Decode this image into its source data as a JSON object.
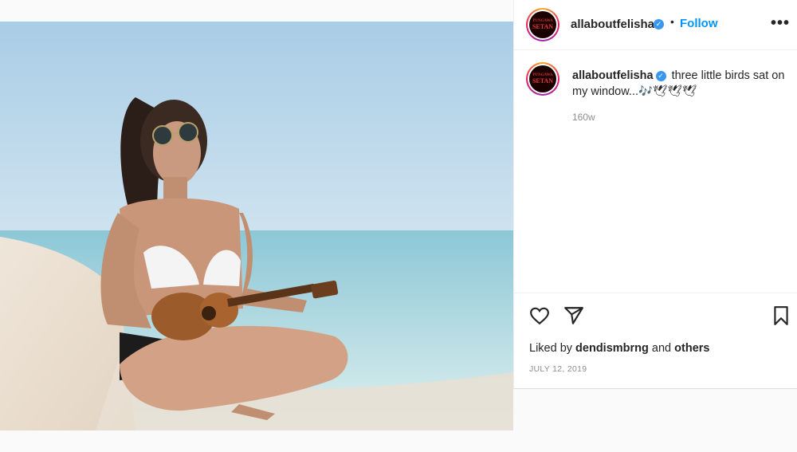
{
  "post": {
    "image_alt": "Woman in white bikini and sunglasses playing a ukulele on a sandy beach",
    "username": "allaboutfelisha",
    "verified_icon": "verified-badge-icon",
    "separator": "•",
    "follow_label": "Follow",
    "more_label": "•••",
    "avatar_text": {
      "line1": "PUNGAWA",
      "line2": "SETAN"
    },
    "caption": {
      "username": "allaboutfelisha",
      "text": "three little birds sat on my window...🎶🕊🕊🕊",
      "time_ago": "160w"
    },
    "actions": {
      "like_icon": "heart-icon",
      "share_icon": "paper-plane-icon",
      "save_icon": "bookmark-icon"
    },
    "likes": {
      "prefix": "Liked by",
      "user": "dendismbrng",
      "and": "and",
      "others": "others"
    },
    "date": "JULY 12, 2019"
  },
  "colors": {
    "link_blue": "#0095f6",
    "verified_blue": "#3897f0",
    "secondary_text": "#8e8e8e"
  }
}
